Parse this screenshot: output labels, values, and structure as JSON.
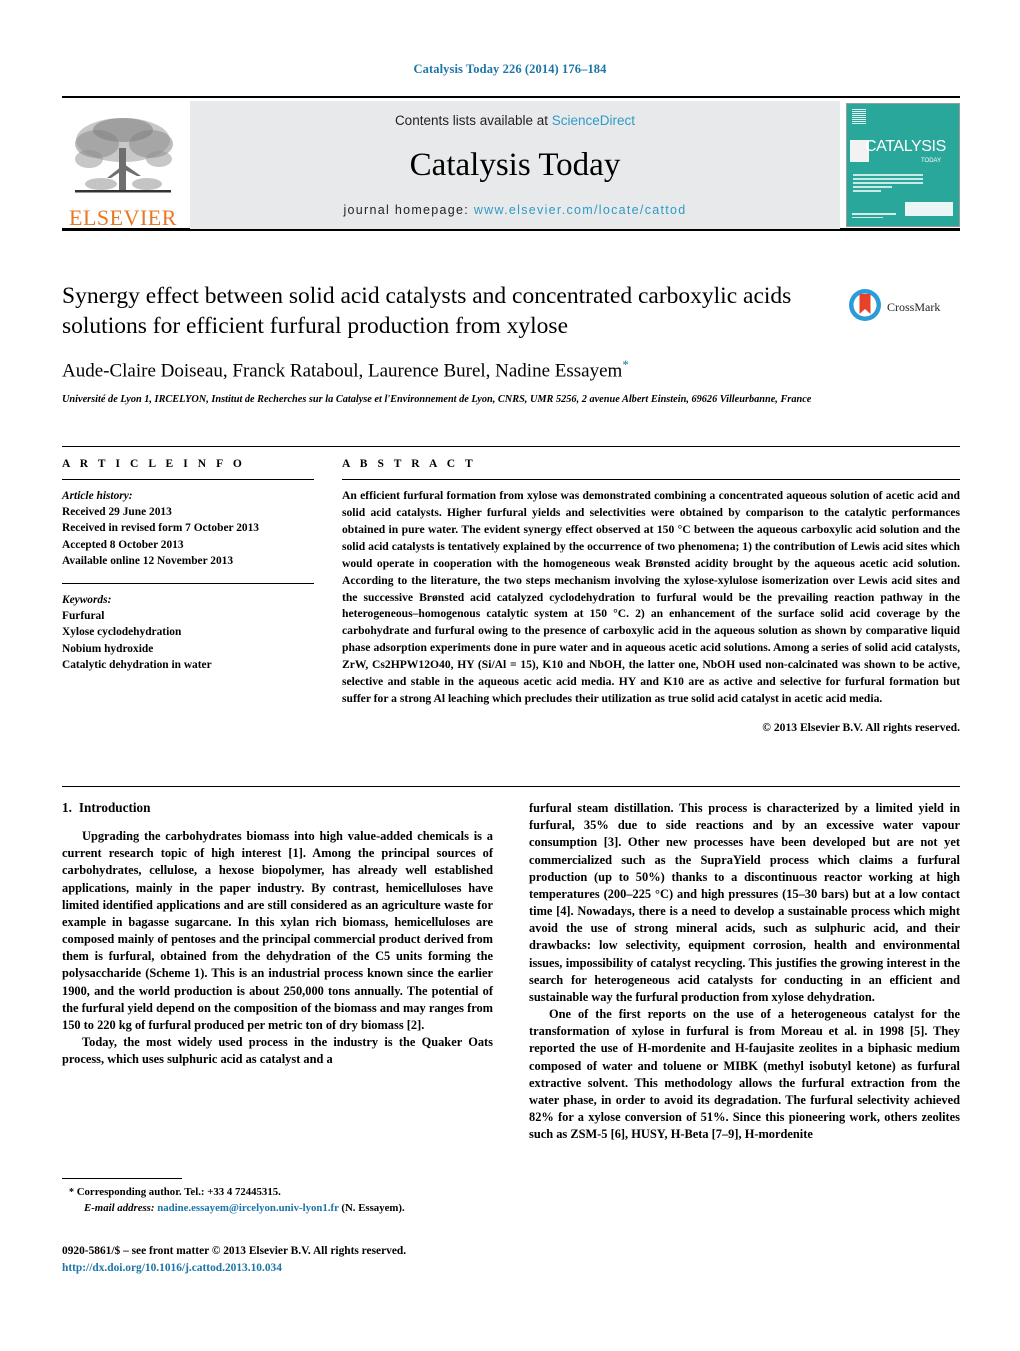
{
  "running_head": "Catalysis Today 226 (2014) 176–184",
  "masthead": {
    "publisher_name": "ELSEVIER",
    "contents_prefix": "Contents lists available at ",
    "contents_link": "ScienceDirect",
    "journal_name": "Catalysis Today",
    "homepage_prefix": "journal homepage: ",
    "homepage_url": "www.elsevier.com/locate/cattod",
    "cover_title": "CATALYSIS",
    "cover_subtitle": "TODAY",
    "cover_bg": "#2aa79b"
  },
  "article": {
    "title": "Synergy effect between solid acid catalysts and concentrated carboxylic acids solutions for efficient furfural production from xylose",
    "authors": "Aude-Claire Doiseau, Franck Rataboul, Laurence Burel, Nadine Essayem",
    "author_star": "*",
    "affiliation": "Université de Lyon 1, IRCELYON, Institut de Recherches sur la Catalyse et l'Environnement de Lyon, CNRS, UMR 5256, 2 avenue Albert Einstein, 69626 Villeurbanne, France",
    "crossmark_label": "CrossMark"
  },
  "article_info": {
    "heading": "A R T I C L E  I N F O",
    "history_label": "Article history:",
    "history": [
      "Received 29 June 2013",
      "Received in revised form 7 October 2013",
      "Accepted 8 October 2013",
      "Available online 12 November 2013"
    ],
    "keywords_label": "Keywords:",
    "keywords": [
      "Furfural",
      "Xylose cyclodehydration",
      "Nobium hydroxide",
      "Catalytic dehydration in water"
    ]
  },
  "abstract": {
    "heading": "A B S T R A C T",
    "text": "An efficient furfural formation from xylose was demonstrated combining a concentrated aqueous solution of acetic acid and solid acid catalysts. Higher furfural yields and selectivities were obtained by comparison to the catalytic performances obtained in pure water. The evident synergy effect observed at 150 °C between the aqueous carboxylic acid solution and the solid acid catalysts is tentatively explained by the occurrence of two phenomena; 1) the contribution of Lewis acid sites which would operate in cooperation with the homogeneous weak Brønsted acidity brought by the aqueous acetic acid solution. According to the literature, the two steps mechanism involving the xylose-xylulose isomerization over Lewis acid sites and the successive Brønsted acid catalyzed cyclodehydration to furfural would be the prevailing reaction pathway in the heterogeneous–homogenous catalytic system at 150 °C. 2) an enhancement of the surface solid acid coverage by the carbohydrate and furfural owing to the presence of carboxylic acid in the aqueous solution as shown by comparative liquid phase adsorption experiments done in pure water and in aqueous acetic acid solutions. Among a series of solid acid catalysts, ZrW, Cs2HPW12O40, HY (Si/Al = 15), K10 and NbOH, the latter one, NbOH used non-calcinated was shown to be active, selective and stable in the aqueous acetic acid media. HY and K10 are as active and selective for furfural formation but suffer for a strong Al leaching which precludes their utilization as true solid acid catalyst in acetic acid media.",
    "copyright": "© 2013 Elsevier B.V. All rights reserved."
  },
  "introduction": {
    "number": "1.",
    "title": "Introduction",
    "left_paragraphs": [
      "Upgrading the carbohydrates biomass into high value-added chemicals is a current research topic of high interest [1]. Among the principal sources of carbohydrates, cellulose, a hexose biopolymer, has already well established applications, mainly in the paper industry. By contrast, hemicelluloses have limited identified applications and are still considered as an agriculture waste for example in bagasse sugarcane. In this xylan rich biomass, hemicelluloses are composed mainly of pentoses and the principal commercial product derived from them is furfural, obtained from the dehydration of the C5 units forming the polysaccharide (Scheme 1). This is an industrial process known since the earlier 1900, and the world production is about 250,000 tons annually. The potential of the furfural yield depend on the composition of the biomass and may ranges from 150 to 220 kg of furfural produced per metric ton of dry biomass [2].",
      "Today, the most widely used process in the industry is the Quaker Oats process, which uses sulphuric acid as catalyst and a"
    ],
    "right_paragraphs": [
      "furfural steam distillation. This process is characterized by a limited yield in furfural, 35% due to side reactions and by an excessive water vapour consumption [3]. Other new processes have been developed but are not yet commercialized such as the SupraYield process which claims a furfural production (up to 50%) thanks to a discontinuous reactor working at high temperatures (200–225 °C) and high pressures (15–30 bars) but at a low contact time [4]. Nowadays, there is a need to develop a sustainable process which might avoid the use of strong mineral acids, such as sulphuric acid, and their drawbacks: low selectivity, equipment corrosion, health and environmental issues, impossibility of catalyst recycling. This justifies the growing interest in the search for heterogeneous acid catalysts for conducting in an efficient and sustainable way the furfural production from xylose dehydration.",
      "One of the first reports on the use of a heterogeneous catalyst for the transformation of xylose in furfural is from Moreau et al. in 1998 [5]. They reported the use of H-mordenite and H-faujasite zeolites in a biphasic medium composed of water and toluene or MIBK (methyl isobutyl ketone) as furfural extractive solvent. This methodology allows the furfural extraction from the water phase, in order to avoid its degradation. The furfural selectivity achieved 82% for a xylose conversion of 51%. Since this pioneering work, others zeolites such as ZSM-5 [6], HUSY, H-Beta [7–9], H-mordenite"
    ]
  },
  "footnotes": {
    "corresponding": "Corresponding author. Tel.: +33 4 72445315.",
    "star": "*",
    "email_label": "E-mail address:",
    "email": "nadine.essayem@ircelyon.univ-lyon1.fr",
    "email_suffix": "(N. Essayem).",
    "issn_line": "0920-5861/$ – see front matter © 2013 Elsevier B.V. All rights reserved.",
    "doi": "http://dx.doi.org/10.1016/j.cattod.2013.10.034"
  },
  "colors": {
    "link": "#1b75a8",
    "sciencedirect": "#2e9bc7",
    "elsevier_orange": "#e87722",
    "cover_teal": "#2aa79b"
  }
}
